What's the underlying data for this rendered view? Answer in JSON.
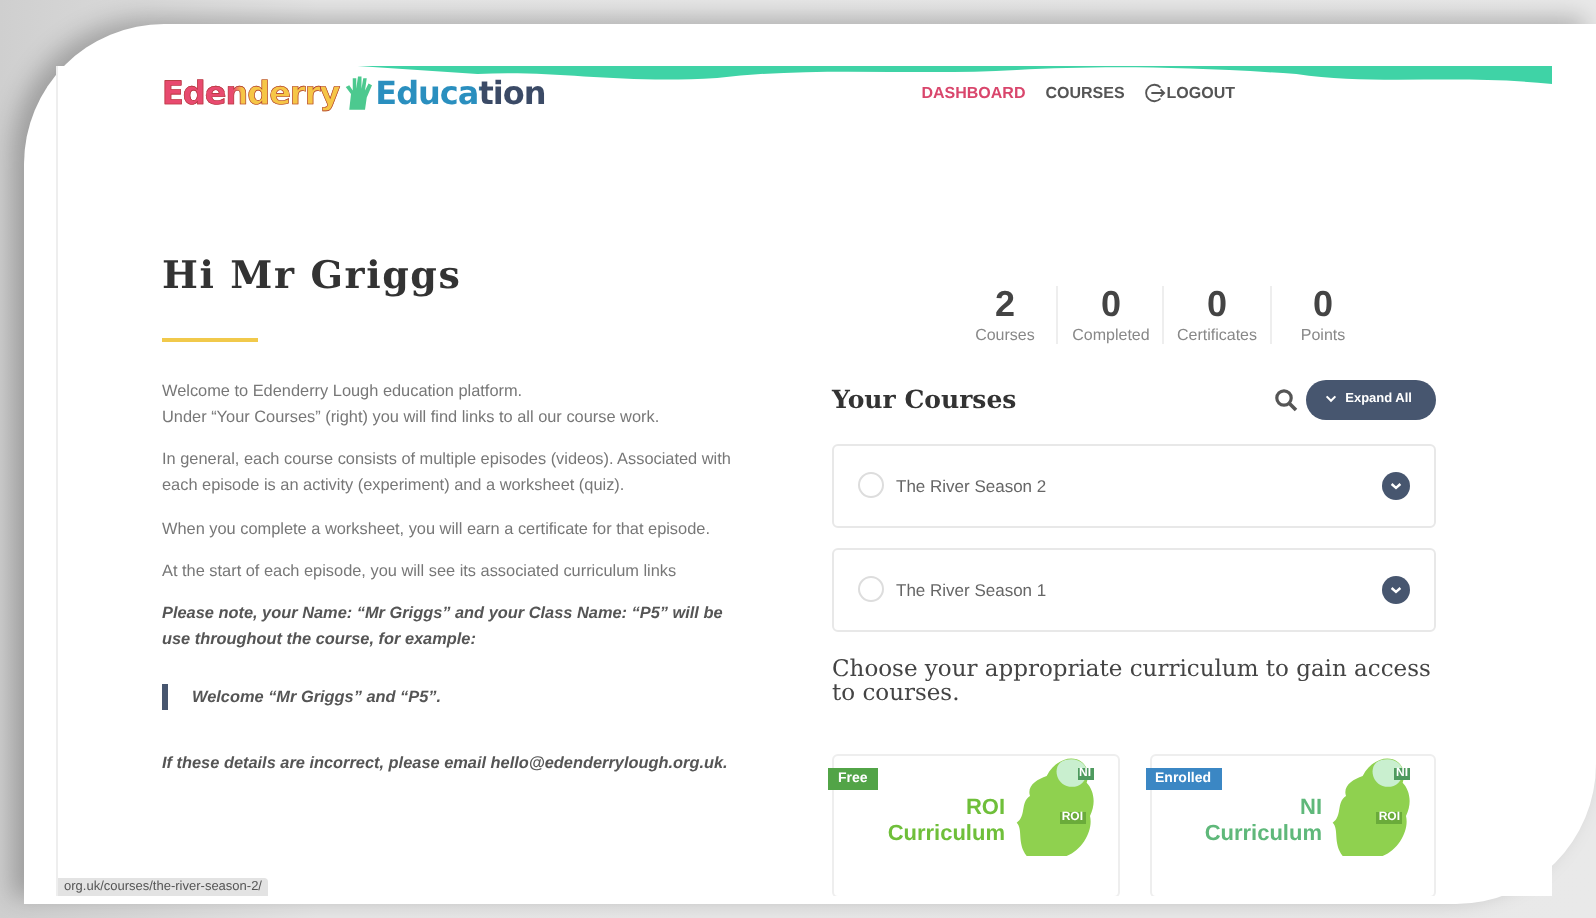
{
  "header": {
    "logo": [
      "Edenderry",
      "Education"
    ],
    "nav": [
      {
        "label": "DASHBOARD",
        "selected": true,
        "icon": false
      },
      {
        "label": "COURSES",
        "selected": false,
        "icon": false
      },
      {
        "label": "LOGOUT",
        "selected": false,
        "icon": true
      }
    ]
  },
  "greeting": "Hi Mr Griggs",
  "paragraphs": [
    {
      "kind": "plain",
      "text": "Welcome to Edenderry Lough education platform.\nUnder “Your Courses” (right) you will find links to all our course work."
    },
    {
      "kind": "plain",
      "text": "In general, each course consists of multiple episodes (videos). Associated with each episode is an activity (experiment) and a worksheet (quiz)."
    },
    {
      "kind": "plain",
      "text": "When you complete a worksheet, you will earn a certificate for that episode."
    },
    {
      "kind": "plain",
      "text": "At the start of each episode, you will see its associated curriculum links"
    },
    {
      "kind": "note",
      "text": "Please note, your Name: “Mr Griggs” and your Class Name:  “P5” will be use throughout the course, for example:"
    },
    {
      "kind": "quote",
      "text": "Welcome “Mr Griggs” and “P5”."
    },
    {
      "kind": "note",
      "text": "If these details are incorrect, please email hello@edenderrylough.org.uk."
    }
  ],
  "stats": [
    {
      "value": "2",
      "label": "Courses"
    },
    {
      "value": "0",
      "label": "Completed"
    },
    {
      "value": "0",
      "label": "Certificates"
    },
    {
      "value": "0",
      "label": "Points"
    }
  ],
  "courses_heading": "Your Courses",
  "expand_button": "Expand All",
  "courses": [
    {
      "title": "The River Season 2",
      "completed": false
    },
    {
      "title": "The River Season 1",
      "completed": false
    }
  ],
  "curriculum_heading": "Choose your appropriate curriculum to gain access to courses.",
  "curricula": [
    {
      "kind": "free",
      "badge": "Free",
      "title": "ROI\nCurriculum",
      "map_labels": [
        "NI",
        "ROI"
      ]
    },
    {
      "kind": "enrolled",
      "badge": "Enrolled",
      "title": "NI\nCurriculum",
      "map_labels": [
        "NI",
        "ROI"
      ]
    }
  ],
  "status_bar": "org.uk/courses/the-river-season-2/"
}
